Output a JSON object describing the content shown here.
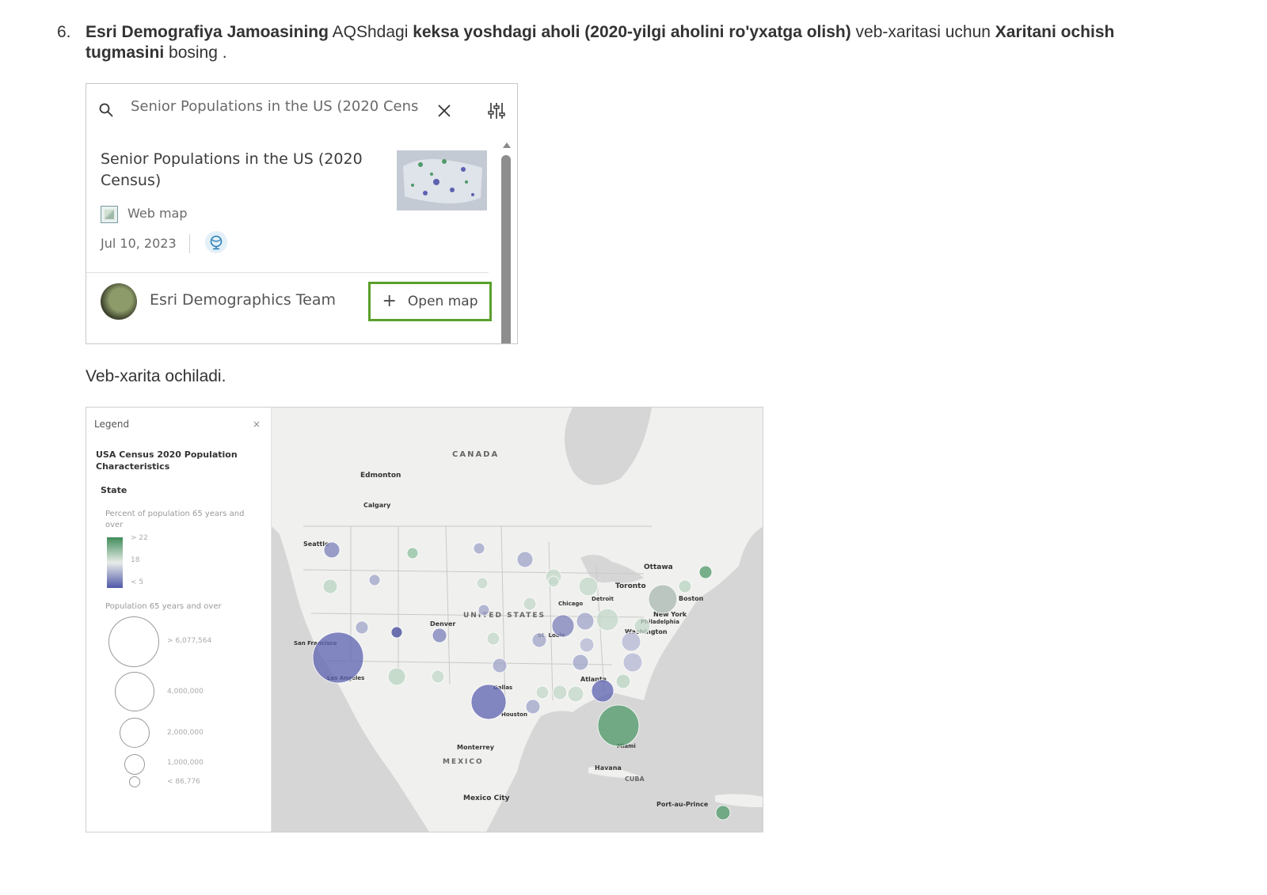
{
  "instruction": {
    "number": "6.",
    "part1_bold": "Esri Demografiya Jamoasining",
    "part2": " AQShdagi ",
    "part3_bold": "keksa yoshdagi aholi (2020-yilgi aholini ro'yxatga olish)",
    "part4": " veb-xaritasi uchun ",
    "part5_bold": "Xaritani ochish tugmasini",
    "part6": " bosing ."
  },
  "search_panel": {
    "search_value": "Senior Populations in the US (2020 Cens",
    "result_title": "Senior Populations in the US (2020 Census)",
    "item_type": "Web map",
    "date": "Jul 10, 2023",
    "owner": "Esri Demographics Team",
    "open_button_label": "Open map",
    "open_button_icon": "plus-icon"
  },
  "caption": "Veb-xarita ochiladi.",
  "map_view": {
    "legend": {
      "title": "Legend",
      "close": "×",
      "layer_title": "USA Census 2020 Population Characteristics",
      "sublayer": "State",
      "color_field": "Percent of population 65 years and over",
      "color_stops": [
        "> 22",
        "18",
        "< 5"
      ],
      "size_field": "Population 65 years and over",
      "size_stops": [
        "> 6,077,564",
        "4,000,000",
        "2,000,000",
        "1,000,000",
        "< 86,776"
      ]
    },
    "labels": {
      "canada": "CANADA",
      "united_states": "UNITED STATES",
      "mexico": "MEXICO",
      "cuba": "CUBA",
      "edmonton": "Edmonton",
      "calgary": "Calgary",
      "seattle": "Seattle",
      "ottawa": "Ottawa",
      "toronto": "Toronto",
      "boston": "Boston",
      "detroit": "Detroit",
      "chicago": "Chicago",
      "new_york": "New York",
      "philadelphia": "Philadelphia",
      "washington": "Washington",
      "denver": "Denver",
      "st_louis": "St. Louis",
      "san_francisco": "San Francisco",
      "los_angeles": "Los Angeles",
      "dallas": "Dallas",
      "houston": "Houston",
      "atlanta": "Atlanta",
      "miami": "Miami",
      "monterrey": "Monterrey",
      "havana": "Havana",
      "mexico_city": "Mexico City",
      "port_au_prince": "Port-au-Prince"
    },
    "colors": {
      "high": "#4f9a6a",
      "mid": "#c8d4cc",
      "low": "#5c62b0"
    }
  }
}
